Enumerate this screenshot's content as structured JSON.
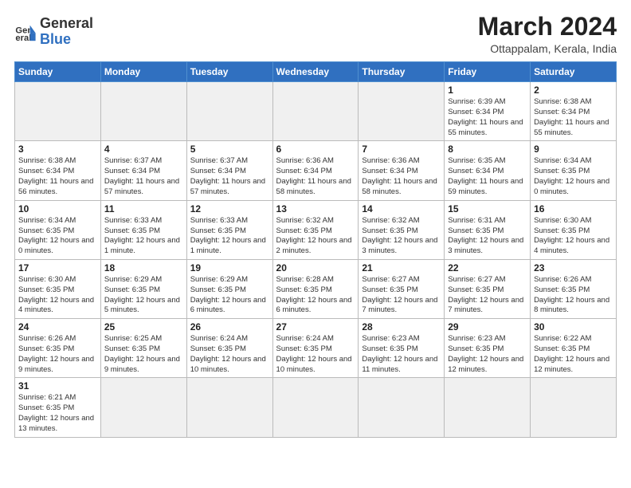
{
  "header": {
    "logo_general": "General",
    "logo_blue": "Blue",
    "month_title": "March 2024",
    "location": "Ottappalam, Kerala, India"
  },
  "weekdays": [
    "Sunday",
    "Monday",
    "Tuesday",
    "Wednesday",
    "Thursday",
    "Friday",
    "Saturday"
  ],
  "weeks": [
    [
      {
        "day": "",
        "info": ""
      },
      {
        "day": "",
        "info": ""
      },
      {
        "day": "",
        "info": ""
      },
      {
        "day": "",
        "info": ""
      },
      {
        "day": "",
        "info": ""
      },
      {
        "day": "1",
        "info": "Sunrise: 6:39 AM\nSunset: 6:34 PM\nDaylight: 11 hours\nand 55 minutes."
      },
      {
        "day": "2",
        "info": "Sunrise: 6:38 AM\nSunset: 6:34 PM\nDaylight: 11 hours\nand 55 minutes."
      }
    ],
    [
      {
        "day": "3",
        "info": "Sunrise: 6:38 AM\nSunset: 6:34 PM\nDaylight: 11 hours\nand 56 minutes."
      },
      {
        "day": "4",
        "info": "Sunrise: 6:37 AM\nSunset: 6:34 PM\nDaylight: 11 hours\nand 57 minutes."
      },
      {
        "day": "5",
        "info": "Sunrise: 6:37 AM\nSunset: 6:34 PM\nDaylight: 11 hours\nand 57 minutes."
      },
      {
        "day": "6",
        "info": "Sunrise: 6:36 AM\nSunset: 6:34 PM\nDaylight: 11 hours\nand 58 minutes."
      },
      {
        "day": "7",
        "info": "Sunrise: 6:36 AM\nSunset: 6:34 PM\nDaylight: 11 hours\nand 58 minutes."
      },
      {
        "day": "8",
        "info": "Sunrise: 6:35 AM\nSunset: 6:34 PM\nDaylight: 11 hours\nand 59 minutes."
      },
      {
        "day": "9",
        "info": "Sunrise: 6:34 AM\nSunset: 6:35 PM\nDaylight: 12 hours\nand 0 minutes."
      }
    ],
    [
      {
        "day": "10",
        "info": "Sunrise: 6:34 AM\nSunset: 6:35 PM\nDaylight: 12 hours\nand 0 minutes."
      },
      {
        "day": "11",
        "info": "Sunrise: 6:33 AM\nSunset: 6:35 PM\nDaylight: 12 hours\nand 1 minute."
      },
      {
        "day": "12",
        "info": "Sunrise: 6:33 AM\nSunset: 6:35 PM\nDaylight: 12 hours\nand 1 minute."
      },
      {
        "day": "13",
        "info": "Sunrise: 6:32 AM\nSunset: 6:35 PM\nDaylight: 12 hours\nand 2 minutes."
      },
      {
        "day": "14",
        "info": "Sunrise: 6:32 AM\nSunset: 6:35 PM\nDaylight: 12 hours\nand 3 minutes."
      },
      {
        "day": "15",
        "info": "Sunrise: 6:31 AM\nSunset: 6:35 PM\nDaylight: 12 hours\nand 3 minutes."
      },
      {
        "day": "16",
        "info": "Sunrise: 6:30 AM\nSunset: 6:35 PM\nDaylight: 12 hours\nand 4 minutes."
      }
    ],
    [
      {
        "day": "17",
        "info": "Sunrise: 6:30 AM\nSunset: 6:35 PM\nDaylight: 12 hours\nand 4 minutes."
      },
      {
        "day": "18",
        "info": "Sunrise: 6:29 AM\nSunset: 6:35 PM\nDaylight: 12 hours\nand 5 minutes."
      },
      {
        "day": "19",
        "info": "Sunrise: 6:29 AM\nSunset: 6:35 PM\nDaylight: 12 hours\nand 6 minutes."
      },
      {
        "day": "20",
        "info": "Sunrise: 6:28 AM\nSunset: 6:35 PM\nDaylight: 12 hours\nand 6 minutes."
      },
      {
        "day": "21",
        "info": "Sunrise: 6:27 AM\nSunset: 6:35 PM\nDaylight: 12 hours\nand 7 minutes."
      },
      {
        "day": "22",
        "info": "Sunrise: 6:27 AM\nSunset: 6:35 PM\nDaylight: 12 hours\nand 7 minutes."
      },
      {
        "day": "23",
        "info": "Sunrise: 6:26 AM\nSunset: 6:35 PM\nDaylight: 12 hours\nand 8 minutes."
      }
    ],
    [
      {
        "day": "24",
        "info": "Sunrise: 6:26 AM\nSunset: 6:35 PM\nDaylight: 12 hours\nand 9 minutes."
      },
      {
        "day": "25",
        "info": "Sunrise: 6:25 AM\nSunset: 6:35 PM\nDaylight: 12 hours\nand 9 minutes."
      },
      {
        "day": "26",
        "info": "Sunrise: 6:24 AM\nSunset: 6:35 PM\nDaylight: 12 hours\nand 10 minutes."
      },
      {
        "day": "27",
        "info": "Sunrise: 6:24 AM\nSunset: 6:35 PM\nDaylight: 12 hours\nand 10 minutes."
      },
      {
        "day": "28",
        "info": "Sunrise: 6:23 AM\nSunset: 6:35 PM\nDaylight: 12 hours\nand 11 minutes."
      },
      {
        "day": "29",
        "info": "Sunrise: 6:23 AM\nSunset: 6:35 PM\nDaylight: 12 hours\nand 12 minutes."
      },
      {
        "day": "30",
        "info": "Sunrise: 6:22 AM\nSunset: 6:35 PM\nDaylight: 12 hours\nand 12 minutes."
      }
    ],
    [
      {
        "day": "31",
        "info": "Sunrise: 6:21 AM\nSunset: 6:35 PM\nDaylight: 12 hours\nand 13 minutes."
      },
      {
        "day": "",
        "info": ""
      },
      {
        "day": "",
        "info": ""
      },
      {
        "day": "",
        "info": ""
      },
      {
        "day": "",
        "info": ""
      },
      {
        "day": "",
        "info": ""
      },
      {
        "day": "",
        "info": ""
      }
    ]
  ]
}
